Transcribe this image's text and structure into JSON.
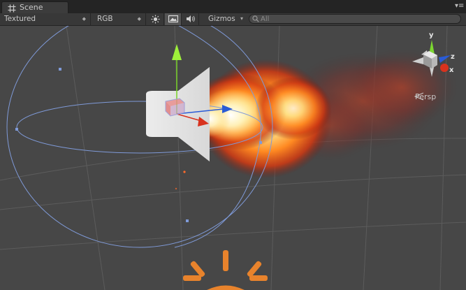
{
  "window": {
    "tab_title": "Scene"
  },
  "toolbar": {
    "render_mode": "Textured",
    "color_mode": "RGB",
    "gizmos_label": "Gizmos",
    "search_placeholder": "All"
  },
  "viewport": {
    "projection_label": "Persp",
    "axes": {
      "y": "y",
      "z": "z",
      "x": "x"
    }
  },
  "colors": {
    "axis_x": "#d8321e",
    "axis_y": "#78d228",
    "axis_z": "#2a5bd6",
    "light_icon": "#e8832c",
    "wire": "#7f9ad8"
  },
  "icons": [
    "scene-tab-icon",
    "sun-icon",
    "image-icon",
    "audio-icon",
    "search-icon",
    "speaker-gizmo-icon",
    "light-gizmo-icon",
    "orientation-gizmo"
  ]
}
